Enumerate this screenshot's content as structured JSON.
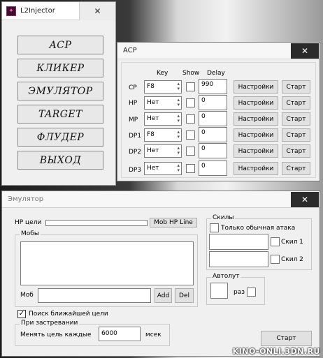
{
  "main_window": {
    "title": "L2Injector",
    "close": "✕",
    "buttons": [
      "ACP",
      "КЛИКЕР",
      "ЭМУЛЯТОР",
      "TARGET",
      "ФЛУДЕР",
      "ВЫХОД"
    ]
  },
  "acp_window": {
    "title": "ACP",
    "close": "✕",
    "headers": {
      "key": "Key",
      "show": "Show",
      "delay": "Delay"
    },
    "rows": [
      {
        "label": "CP",
        "key": "F8",
        "delay": "990",
        "settings": "Настройки",
        "start": "Старт"
      },
      {
        "label": "HP",
        "key": "Нет",
        "delay": "0",
        "settings": "Настройки",
        "start": "Старт"
      },
      {
        "label": "MP",
        "key": "Нет",
        "delay": "0",
        "settings": "Настройки",
        "start": "Старт"
      },
      {
        "label": "DP1",
        "key": "F8",
        "delay": "0",
        "settings": "Настройки",
        "start": "Старт"
      },
      {
        "label": "DP2",
        "key": "Нет",
        "delay": "0",
        "settings": "Настройки",
        "start": "Старт"
      },
      {
        "label": "DP3",
        "key": "Нет",
        "delay": "0",
        "settings": "Настройки",
        "start": "Старт"
      }
    ]
  },
  "emulator_window": {
    "title": "Эмулятор",
    "close": "✕",
    "hp_label": "HP цели",
    "mob_hp_line": "Mob HP Line",
    "mobs_group": "Мобы",
    "mob_label": "Моб",
    "add": "Add",
    "del": "Del",
    "search_nearest": "Поиск ближайшей цели",
    "stuck_group": "При застревании",
    "change_target": "Менять цель каждые",
    "interval": "6000",
    "unit": "мсек",
    "skills_group": "Скилы",
    "only_basic_attack": "Только обычная атака",
    "skill1": "Скил 1",
    "skill2": "Скил 2",
    "autoloot_group": "Автолут",
    "times": "раз",
    "start": "Старт"
  },
  "watermark": "KINO-ONLI.3DN.RU"
}
